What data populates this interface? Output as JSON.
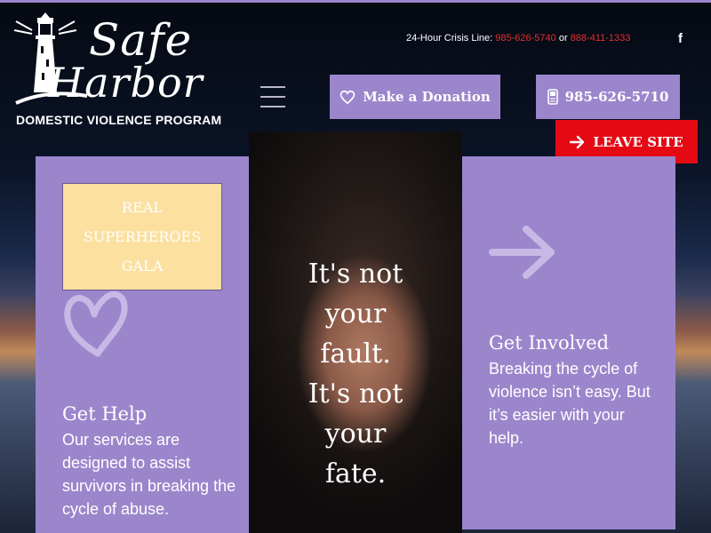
{
  "brand": {
    "name_line1": "Safe",
    "name_line2": "Harbor",
    "subtitle": "DOMESTIC VIOLENCE PROGRAM"
  },
  "crisis": {
    "label": "24-Hour Crisis Line:",
    "phone1": "985-626-5740",
    "separator": "or",
    "phone2": "888-411-1333"
  },
  "social": {
    "facebook": "f"
  },
  "nav": {
    "donate_label": "Make a Donation",
    "phone_label": "985-626-5710",
    "leave_label": "LEAVE SITE"
  },
  "gala": {
    "text": "REAL SUPERHEROES GALA"
  },
  "hero": {
    "line1": "It's not",
    "line2": "your",
    "line3": "fault.",
    "line4": "It's not",
    "line5": "your",
    "line6": "fate."
  },
  "cards": {
    "help": {
      "title": "Get Help",
      "body": "Our services are designed to assist survivors in breaking the cycle of abuse."
    },
    "involved": {
      "title": "Get Involved",
      "body": "Breaking the cycle of violence isn’t easy. But it’s easier with your help."
    }
  },
  "colors": {
    "accent": "#9b86cc",
    "leave": "#e50914",
    "crisis_red": "#e03030",
    "gala_bg": "#fbe0a0"
  },
  "icons": [
    "lighthouse-icon",
    "facebook-icon",
    "menu-icon",
    "heart-icon",
    "phone-icon",
    "arrow-right-icon",
    "heart-outline-icon",
    "arrow-big-icon"
  ]
}
